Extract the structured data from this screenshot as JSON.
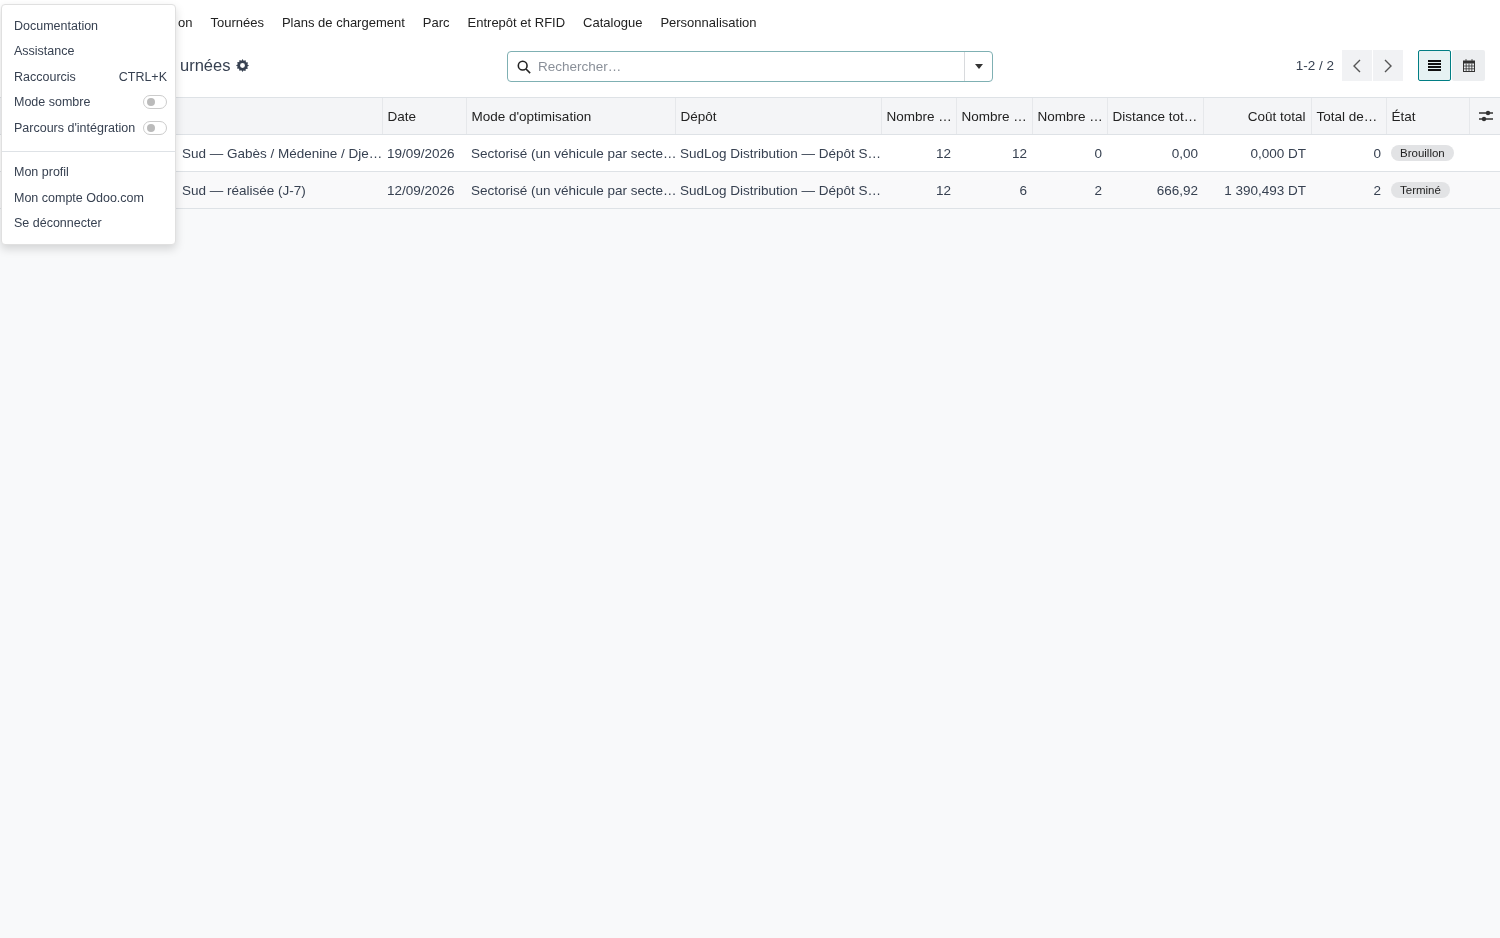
{
  "navbar": {
    "items": [
      "on",
      "Tournées",
      "Plans de chargement",
      "Parc",
      "Entrepôt et RFID",
      "Catalogue",
      "Personnalisation"
    ]
  },
  "breadcrumb": {
    "title": "urnées"
  },
  "search": {
    "placeholder": "Rechercher…"
  },
  "pager": {
    "text": "1-2 / 2"
  },
  "views": [
    {
      "kind": "list",
      "selected": true
    },
    {
      "kind": "calendar",
      "selected": false
    }
  ],
  "table": {
    "columns": [
      "Date",
      "Mode d'optimisation",
      "Dépôt",
      "Nombre …",
      "Nombre …",
      "Nombre …",
      "Distance tot…",
      "Coût total",
      "Total de…",
      "État"
    ],
    "rows": [
      {
        "name": "Sud — Gabès / Médenine / Dje…",
        "cells": [
          "19/09/2026",
          "Sectorisé (un véhicule par secte…",
          "SudLog Distribution — Dépôt S…",
          "12",
          "12",
          "0",
          "0,00",
          "0,000 DT",
          "0"
        ],
        "state": "Brouillon"
      },
      {
        "name": "Sud — réalisée (J-7)",
        "cells": [
          "12/09/2026",
          "Sectorisé (un véhicule par secte…",
          "SudLog Distribution — Dépôt S…",
          "12",
          "6",
          "2",
          "666,92",
          "1 390,493 DT",
          "2"
        ],
        "state": "Terminé"
      }
    ]
  },
  "user_menu": {
    "groups": [
      [
        {
          "kind": "link",
          "label": "Documentation"
        },
        {
          "kind": "link",
          "label": "Assistance"
        },
        {
          "kind": "shortcut",
          "label": "Raccourcis",
          "shortcut": "CTRL+K"
        },
        {
          "kind": "toggle",
          "label": "Mode sombre",
          "on": false
        },
        {
          "kind": "toggle",
          "label": "Parcours d'intégration",
          "on": false
        }
      ],
      [
        {
          "kind": "link",
          "label": "Mon profil"
        },
        {
          "kind": "link",
          "label": "Mon compte Odoo.com"
        },
        {
          "kind": "link",
          "label": "Se déconnecter"
        }
      ]
    ]
  }
}
